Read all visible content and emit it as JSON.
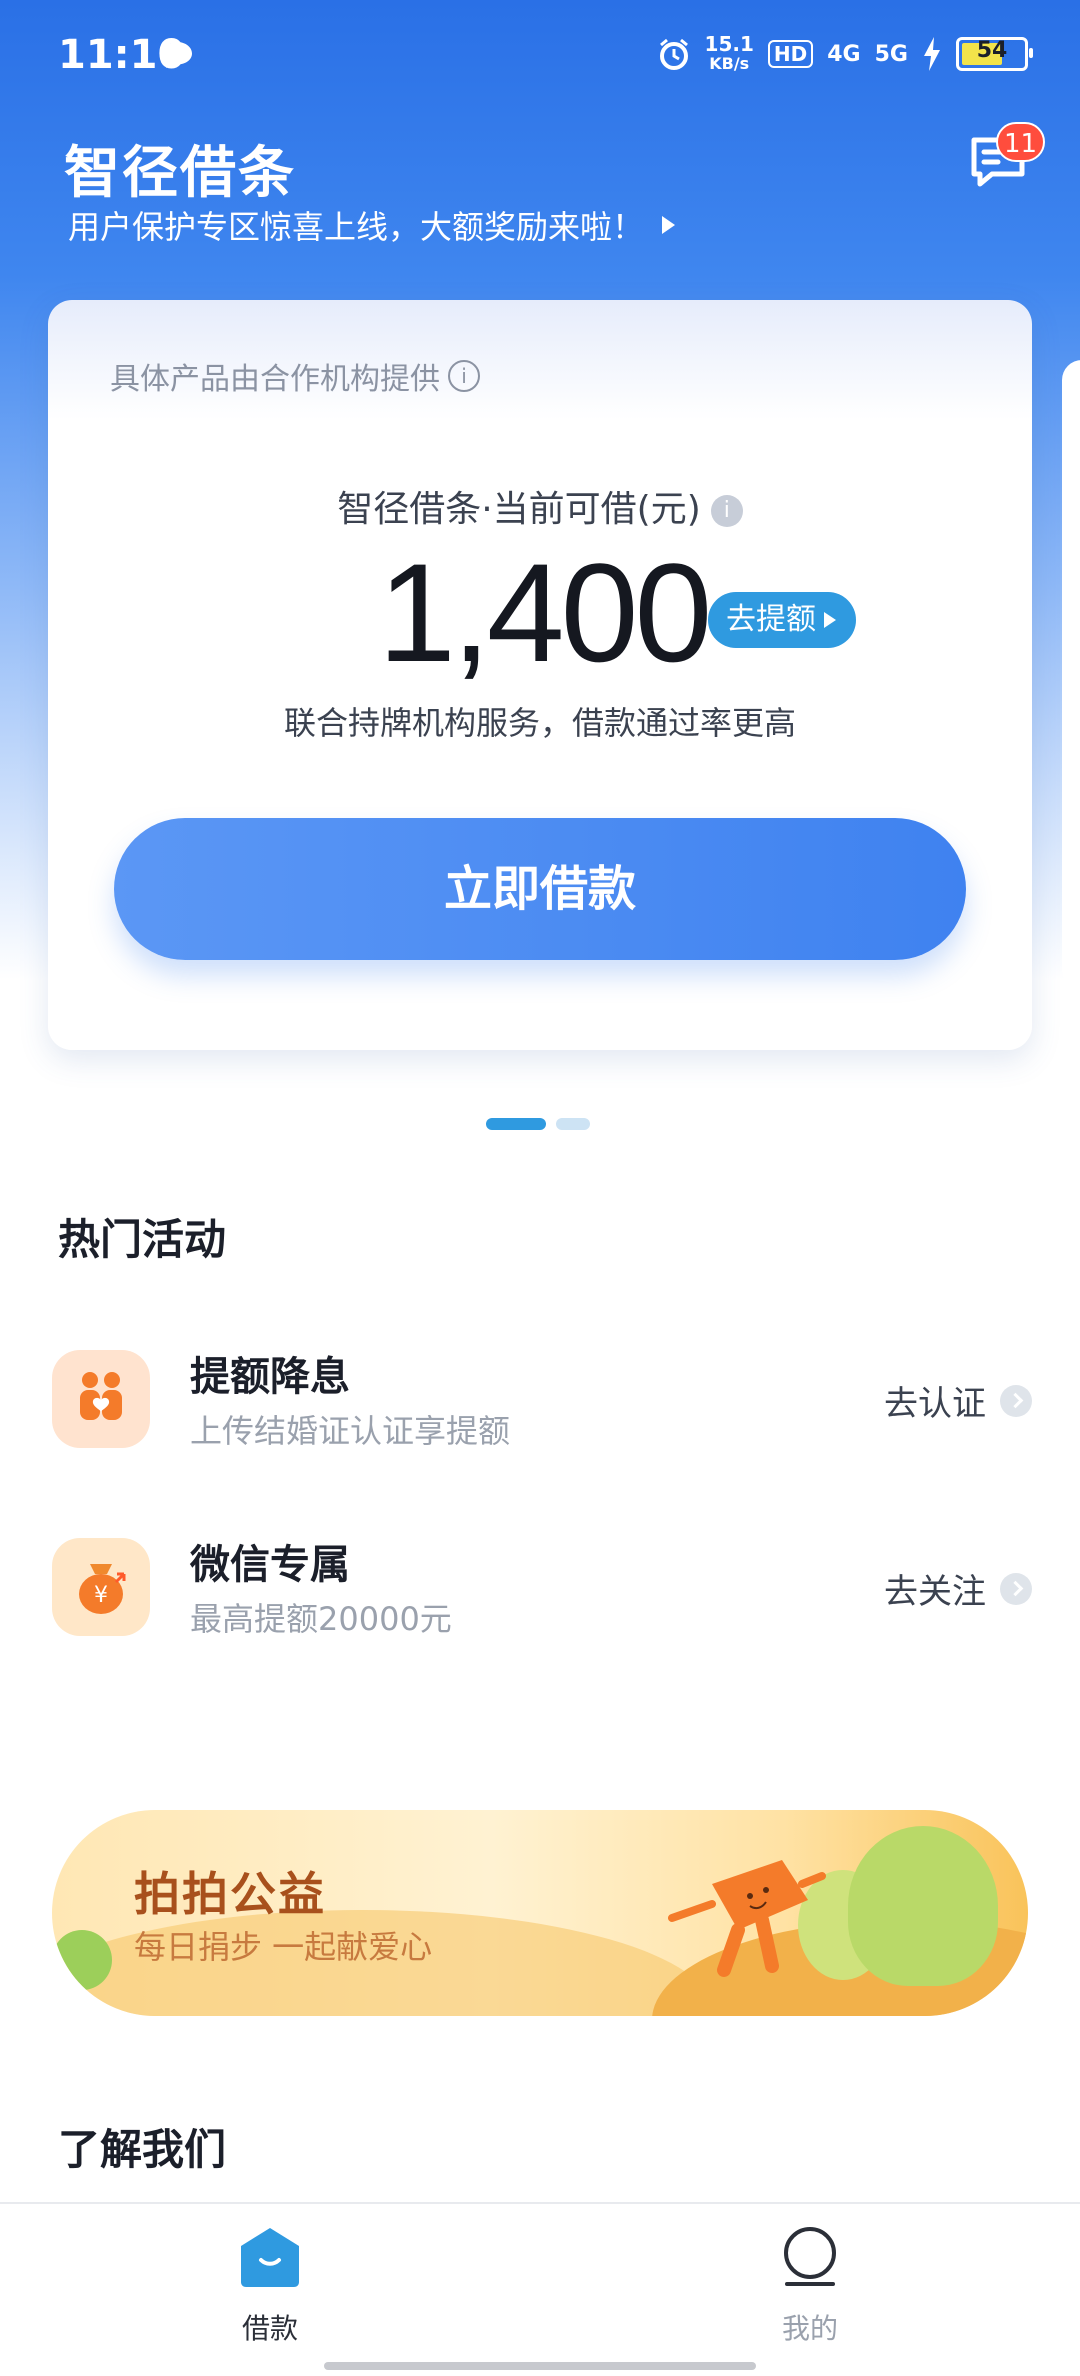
{
  "status_bar": {
    "time": "11:10",
    "net_speed": "15.1",
    "net_unit": "KB/s",
    "hd": "HD",
    "sig1": "4G",
    "sig2": "5G",
    "battery": "54"
  },
  "header": {
    "title": "智径借条",
    "subtitle": "用户保护专区惊喜上线，大额奖励来啦！",
    "message_count": "11"
  },
  "loan_card": {
    "provider_note": "具体产品由合作机构提供",
    "quota_label": "智径借条·当前可借(元)",
    "amount": "1,400",
    "raise_label": "去提额",
    "service_note": "联合持牌机构服务，借款通过率更高",
    "borrow_button": "立即借款"
  },
  "hot": {
    "title": "热门活动",
    "items": [
      {
        "title": "提额降息",
        "subtitle": "上传结婚证认证享提额",
        "action": "去认证",
        "icon": "couple-heart-icon"
      },
      {
        "title": "微信专属",
        "subtitle": "最高提额20000元",
        "action": "去关注",
        "icon": "money-bag-icon"
      }
    ]
  },
  "banner": {
    "title": "拍拍公益",
    "subtitle": "每日捐步 一起献爱心"
  },
  "about": {
    "title": "了解我们"
  },
  "tabbar": {
    "items": [
      {
        "label": "借款",
        "icon": "home-icon",
        "active": true
      },
      {
        "label": "我的",
        "icon": "profile-icon",
        "active": false
      }
    ]
  },
  "colors": {
    "primary": "#3f82f0",
    "accent": "#2f9ae0",
    "badge": "#ff4d3d"
  }
}
